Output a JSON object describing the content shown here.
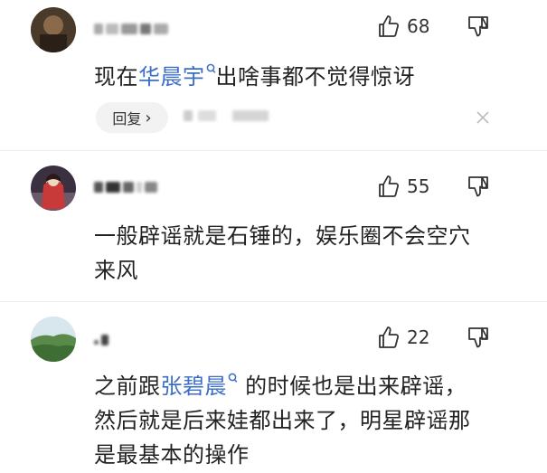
{
  "comments": [
    {
      "avatar": "avatar-dark-portrait",
      "likes": "68",
      "text_before": "现在",
      "mention": "华晨宇",
      "text_after": "出啥事都不觉得惊讶",
      "reply_label": "回复",
      "reply_chevron": "›"
    },
    {
      "avatar": "avatar-red-dress",
      "likes": "55",
      "line1": "一般辟谣就是石锤的，娱乐圈不会空穴",
      "line2": "来风"
    },
    {
      "avatar": "avatar-landscape",
      "likes": "22",
      "text_before": "之前跟",
      "mention": "张碧晨",
      "text_after": "的时候也是出来辟谣，",
      "line2": "然后就是后来娃都出来了，明星辟谣那",
      "line3": "是最基本的操作"
    }
  ],
  "icons": {
    "like": "thumbs-up-icon",
    "dislike": "thumbs-down-icon",
    "mention": "search-icon",
    "close": "close-icon"
  },
  "colors": {
    "mention": "#3e6fc6",
    "text": "#222222",
    "reply_bg": "#f2f2f2"
  }
}
